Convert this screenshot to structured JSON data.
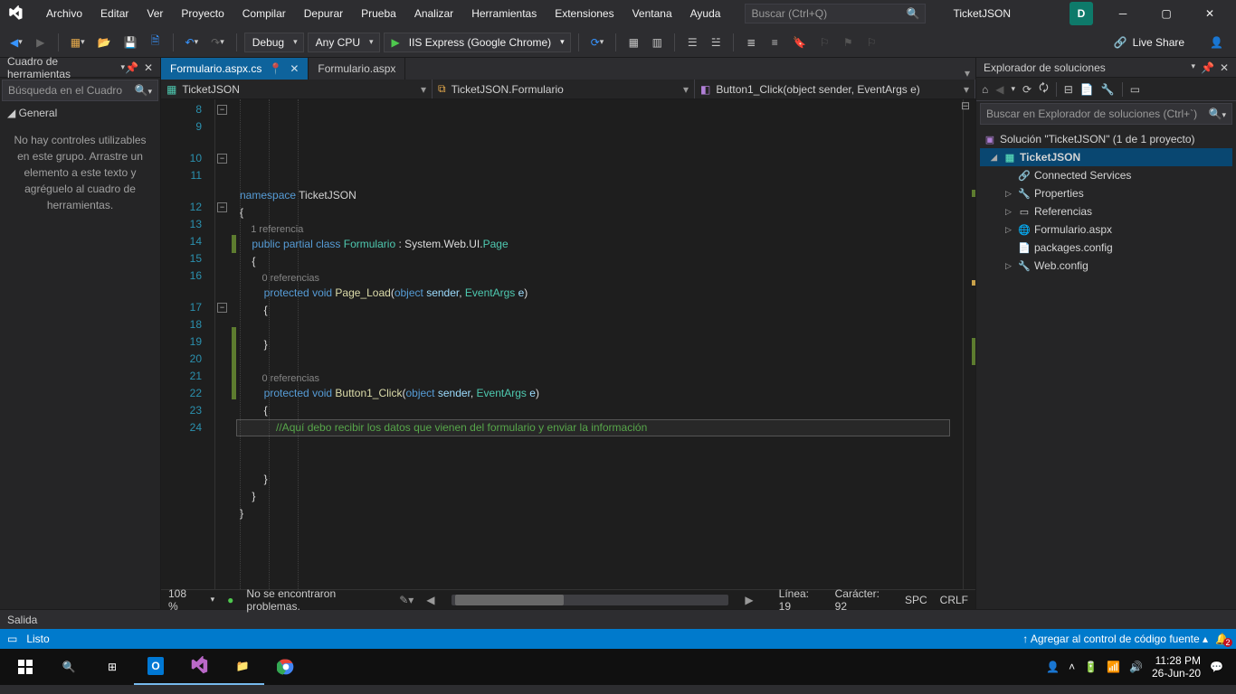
{
  "titlebar": {
    "menus": [
      "Archivo",
      "Editar",
      "Ver",
      "Proyecto",
      "Compilar",
      "Depurar",
      "Prueba",
      "Analizar",
      "Herramientas",
      "Extensiones",
      "Ventana",
      "Ayuda"
    ],
    "search_placeholder": "Buscar (Ctrl+Q)",
    "solution": "TicketJSON",
    "user_initial": "D"
  },
  "toolbar": {
    "config": "Debug",
    "platform": "Any CPU",
    "run_label": "IIS Express (Google Chrome)",
    "live_share": "Live Share"
  },
  "toolbox": {
    "title": "Cuadro de herramientas",
    "search_placeholder": "Búsqueda en el Cuadro",
    "group": "General",
    "empty": "No hay controles utilizables en este grupo. Arrastre un elemento a este texto y agréguelo al cuadro de herramientas."
  },
  "tabs": {
    "active": "Formulario.aspx.cs",
    "other": "Formulario.aspx"
  },
  "navbar": {
    "project": "TicketJSON",
    "class": "TicketJSON.Formulario",
    "member": "Button1_Click(object sender, EventArgs e)"
  },
  "code": {
    "first_line": 8,
    "lines": [
      {
        "n": 8,
        "html": "<span class='kw'>namespace</span> <span class='ns'>TicketJSON</span>"
      },
      {
        "n": 9,
        "html": "{"
      },
      {
        "n": "",
        "html": "    <span class='codelens'>1 referencia</span>",
        "lens": true
      },
      {
        "n": 10,
        "html": "    <span class='kw'>public</span> <span class='kw'>partial</span> <span class='kw'>class</span> <span class='type'>Formulario</span> : System.Web.UI.<span class='type'>Page</span>"
      },
      {
        "n": 11,
        "html": "    {"
      },
      {
        "n": "",
        "html": "        <span class='codelens'>0 referencias</span>",
        "lens": true
      },
      {
        "n": 12,
        "html": "        <span class='kw'>protected</span> <span class='kw'>void</span> <span class='mname'>Page_Load</span>(<span class='kw'>object</span> <span class='param'>sender</span>, <span class='type'>EventArgs</span> <span class='param'>e</span>)"
      },
      {
        "n": 13,
        "html": "        {"
      },
      {
        "n": 14,
        "html": ""
      },
      {
        "n": 15,
        "html": "        }"
      },
      {
        "n": 16,
        "html": ""
      },
      {
        "n": "",
        "html": "        <span class='codelens'>0 referencias</span>",
        "lens": true
      },
      {
        "n": 17,
        "html": "        <span class='kw'>protected</span> <span class='kw'>void</span> <span class='mname'>Button1_Click</span>(<span class='kw'>object</span> <span class='param'>sender</span>, <span class='type'>EventArgs</span> <span class='param'>e</span>)"
      },
      {
        "n": 18,
        "html": "        {"
      },
      {
        "n": 19,
        "html": "            <span class='comment'>//Aquí debo recibir los datos que vienen del formulario y enviar la información</span>",
        "hl": true
      },
      {
        "n": 20,
        "html": ""
      },
      {
        "n": 21,
        "html": ""
      },
      {
        "n": 22,
        "html": "        }"
      },
      {
        "n": 23,
        "html": "    }"
      },
      {
        "n": 24,
        "html": "}"
      }
    ]
  },
  "editor_status": {
    "zoom": "108 %",
    "issues": "No se encontraron problemas.",
    "line": "Línea: 19",
    "col": "Carácter: 92",
    "spc": "SPC",
    "crlf": "CRLF"
  },
  "solution_explorer": {
    "title": "Explorador de soluciones",
    "search_placeholder": "Buscar en Explorador de soluciones (Ctrl+`)",
    "root": "Solución \"TicketJSON\" (1 de 1 proyecto)",
    "project": "TicketJSON",
    "nodes": [
      "Connected Services",
      "Properties",
      "Referencias",
      "Formulario.aspx",
      "packages.config",
      "Web.config"
    ]
  },
  "output": {
    "title": "Salida"
  },
  "statusbar": {
    "ready": "Listo",
    "source_control": "Agregar al control de código fuente"
  },
  "taskbar": {
    "time": "11:28 PM",
    "date": "26-Jun-20"
  }
}
